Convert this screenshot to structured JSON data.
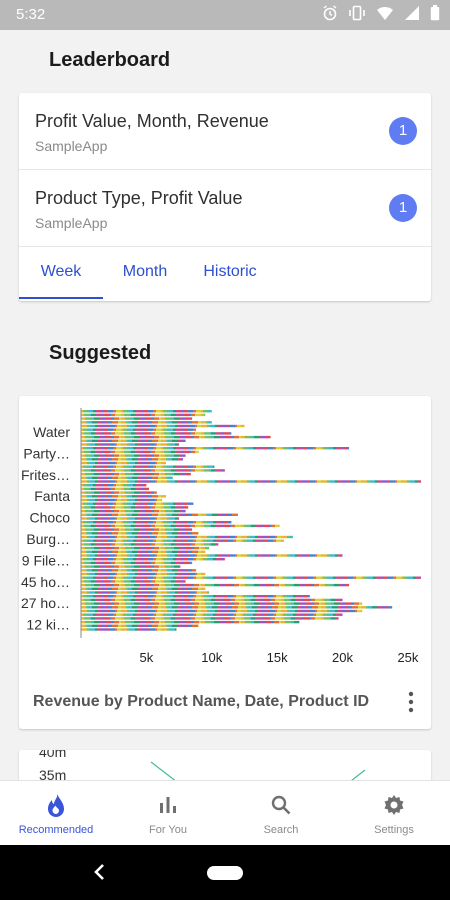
{
  "status_bar": {
    "time": "5:32"
  },
  "leaderboard": {
    "title": "Leaderboard",
    "items": [
      {
        "title": "Profit Value, Month, Revenue",
        "subtitle": "SampleApp",
        "badge": "1"
      },
      {
        "title": "Product Type, Profit Value",
        "subtitle": "SampleApp",
        "badge": "1"
      }
    ],
    "tabs": [
      {
        "label": "Week",
        "active": true
      },
      {
        "label": "Month",
        "active": false
      },
      {
        "label": "Historic",
        "active": false
      }
    ]
  },
  "suggested": {
    "title": "Suggested",
    "card_title": "Revenue by Product Name, Date, Product ID"
  },
  "chart_data": [
    {
      "type": "bar",
      "orientation": "horizontal",
      "stacked": true,
      "title": "Revenue by Product Name, Date, Product ID",
      "categories": [
        "Water",
        "Party…",
        "Frites…",
        "Fanta",
        "Choco",
        "Burg…",
        "9 File…",
        "45 ho…",
        "27 ho…",
        "12 ki…"
      ],
      "x_ticks": [
        "5k",
        "10k",
        "15k",
        "20k",
        "25k"
      ],
      "xlim": [
        0,
        26000
      ],
      "bar_totals": [
        10000,
        9500,
        8500,
        10000,
        12500,
        8800,
        11500,
        14500,
        8000,
        7500,
        20500,
        9000,
        8000,
        7800,
        6500,
        10200,
        11000,
        8400,
        7000,
        26000,
        5000,
        5200,
        5800,
        6500,
        6200,
        8600,
        8200,
        8000,
        12000,
        7500,
        11500,
        15200,
        8500,
        9000,
        16200,
        15500,
        10500,
        9800,
        9500,
        20000,
        11000,
        8500,
        7600,
        8800,
        9500,
        26000,
        8000,
        20500,
        9500,
        9800,
        17500,
        20000,
        21500,
        23800,
        21500,
        20000,
        19700,
        16700,
        9000,
        7300
      ]
    },
    {
      "type": "line",
      "y_ticks": [
        "40m",
        "35m"
      ]
    }
  ],
  "colors": {
    "accent": "#3a55d8",
    "badge": "#5f7cf2",
    "bar_palette": [
      "#e6b23a",
      "#4a7fd6",
      "#c94d8c",
      "#6cc26a",
      "#e07033",
      "#8a5ad0",
      "#3fb8c8",
      "#d9d13a",
      "#e0485a",
      "#2a9d6c"
    ]
  },
  "bottom_nav": [
    {
      "label": "Recommended",
      "icon": "flame-icon",
      "active": true
    },
    {
      "label": "For You",
      "icon": "bar-chart-icon",
      "active": false
    },
    {
      "label": "Search",
      "icon": "search-icon",
      "active": false
    },
    {
      "label": "Settings",
      "icon": "gear-icon",
      "active": false
    }
  ]
}
